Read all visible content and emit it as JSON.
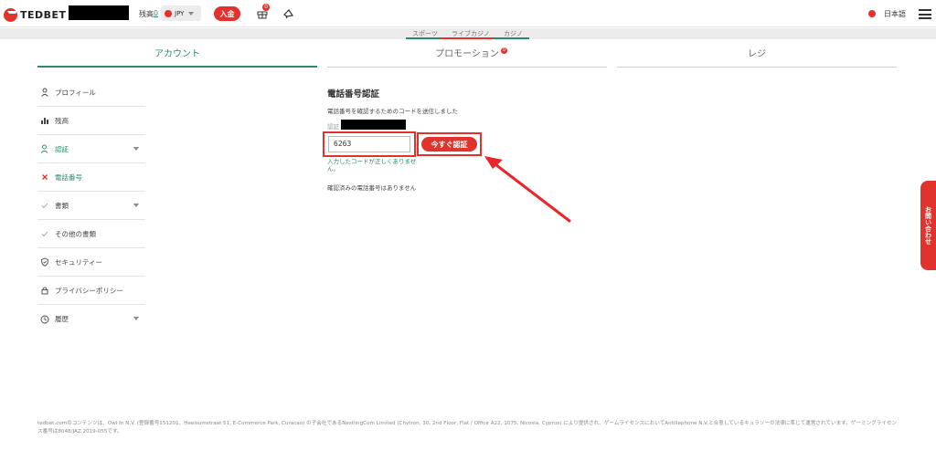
{
  "header": {
    "logo_text": "TEDBET",
    "balance_label": "残高",
    "balance_value": "0",
    "currency": "JPY",
    "deposit_label": "入金",
    "gift_badge": "0",
    "language": "日本語"
  },
  "subnav": {
    "items": [
      "スポーツ",
      "ライブカジノ",
      "カジノ"
    ]
  },
  "tabs": [
    {
      "label": "アカウント"
    },
    {
      "label": "プロモーション",
      "badge": "0"
    },
    {
      "label": "レジ"
    }
  ],
  "sidebar": {
    "items": [
      {
        "label": "プロフィール",
        "icon": "user-icon"
      },
      {
        "label": "残高",
        "icon": "chart-bars-icon"
      },
      {
        "label": "認証",
        "icon": "user-verify-icon"
      },
      {
        "label": "電話番号",
        "icon": "x-icon"
      },
      {
        "label": "書類",
        "icon": "check-icon"
      },
      {
        "label": "その他の書類",
        "icon": "check-icon"
      },
      {
        "label": "セキュリティー",
        "icon": "shield-icon"
      },
      {
        "label": "プライバシーポリシー",
        "icon": "lock-icon"
      },
      {
        "label": "履歴",
        "icon": "clock-icon"
      }
    ]
  },
  "main": {
    "title": "電話番号認証",
    "description": "電話番号を確認するためのコードを送信しました",
    "phone_label": "認証",
    "code_value": "6263",
    "verify_button": "今すぐ認証",
    "error_message": "入力したコードが正しくありません。",
    "no_verified": "確認済みの電話番号はありません"
  },
  "contact_tab": "お問い合わせ",
  "footer": {
    "text": "tedbet.comのコンテンツは、Owl In N.V. (登録番号151201、Heelsumstraat 51, E-Commerce Park, Curacao) の子会社であるNestlingCom Limited (Chytron, 30, 2nd Floor, Flat / Office A22, 1075, Nicosia, Cyprus) により提供され、ゲームライセンスにおいてAntillephone N.V.と合意しているキュラソーの法律に準じて運営されています。ゲーミングライセンス番号は8048/JAZ 2019-055です。"
  },
  "colors": {
    "accent_red": "#e1322d",
    "accent_green": "#2a8c63"
  }
}
